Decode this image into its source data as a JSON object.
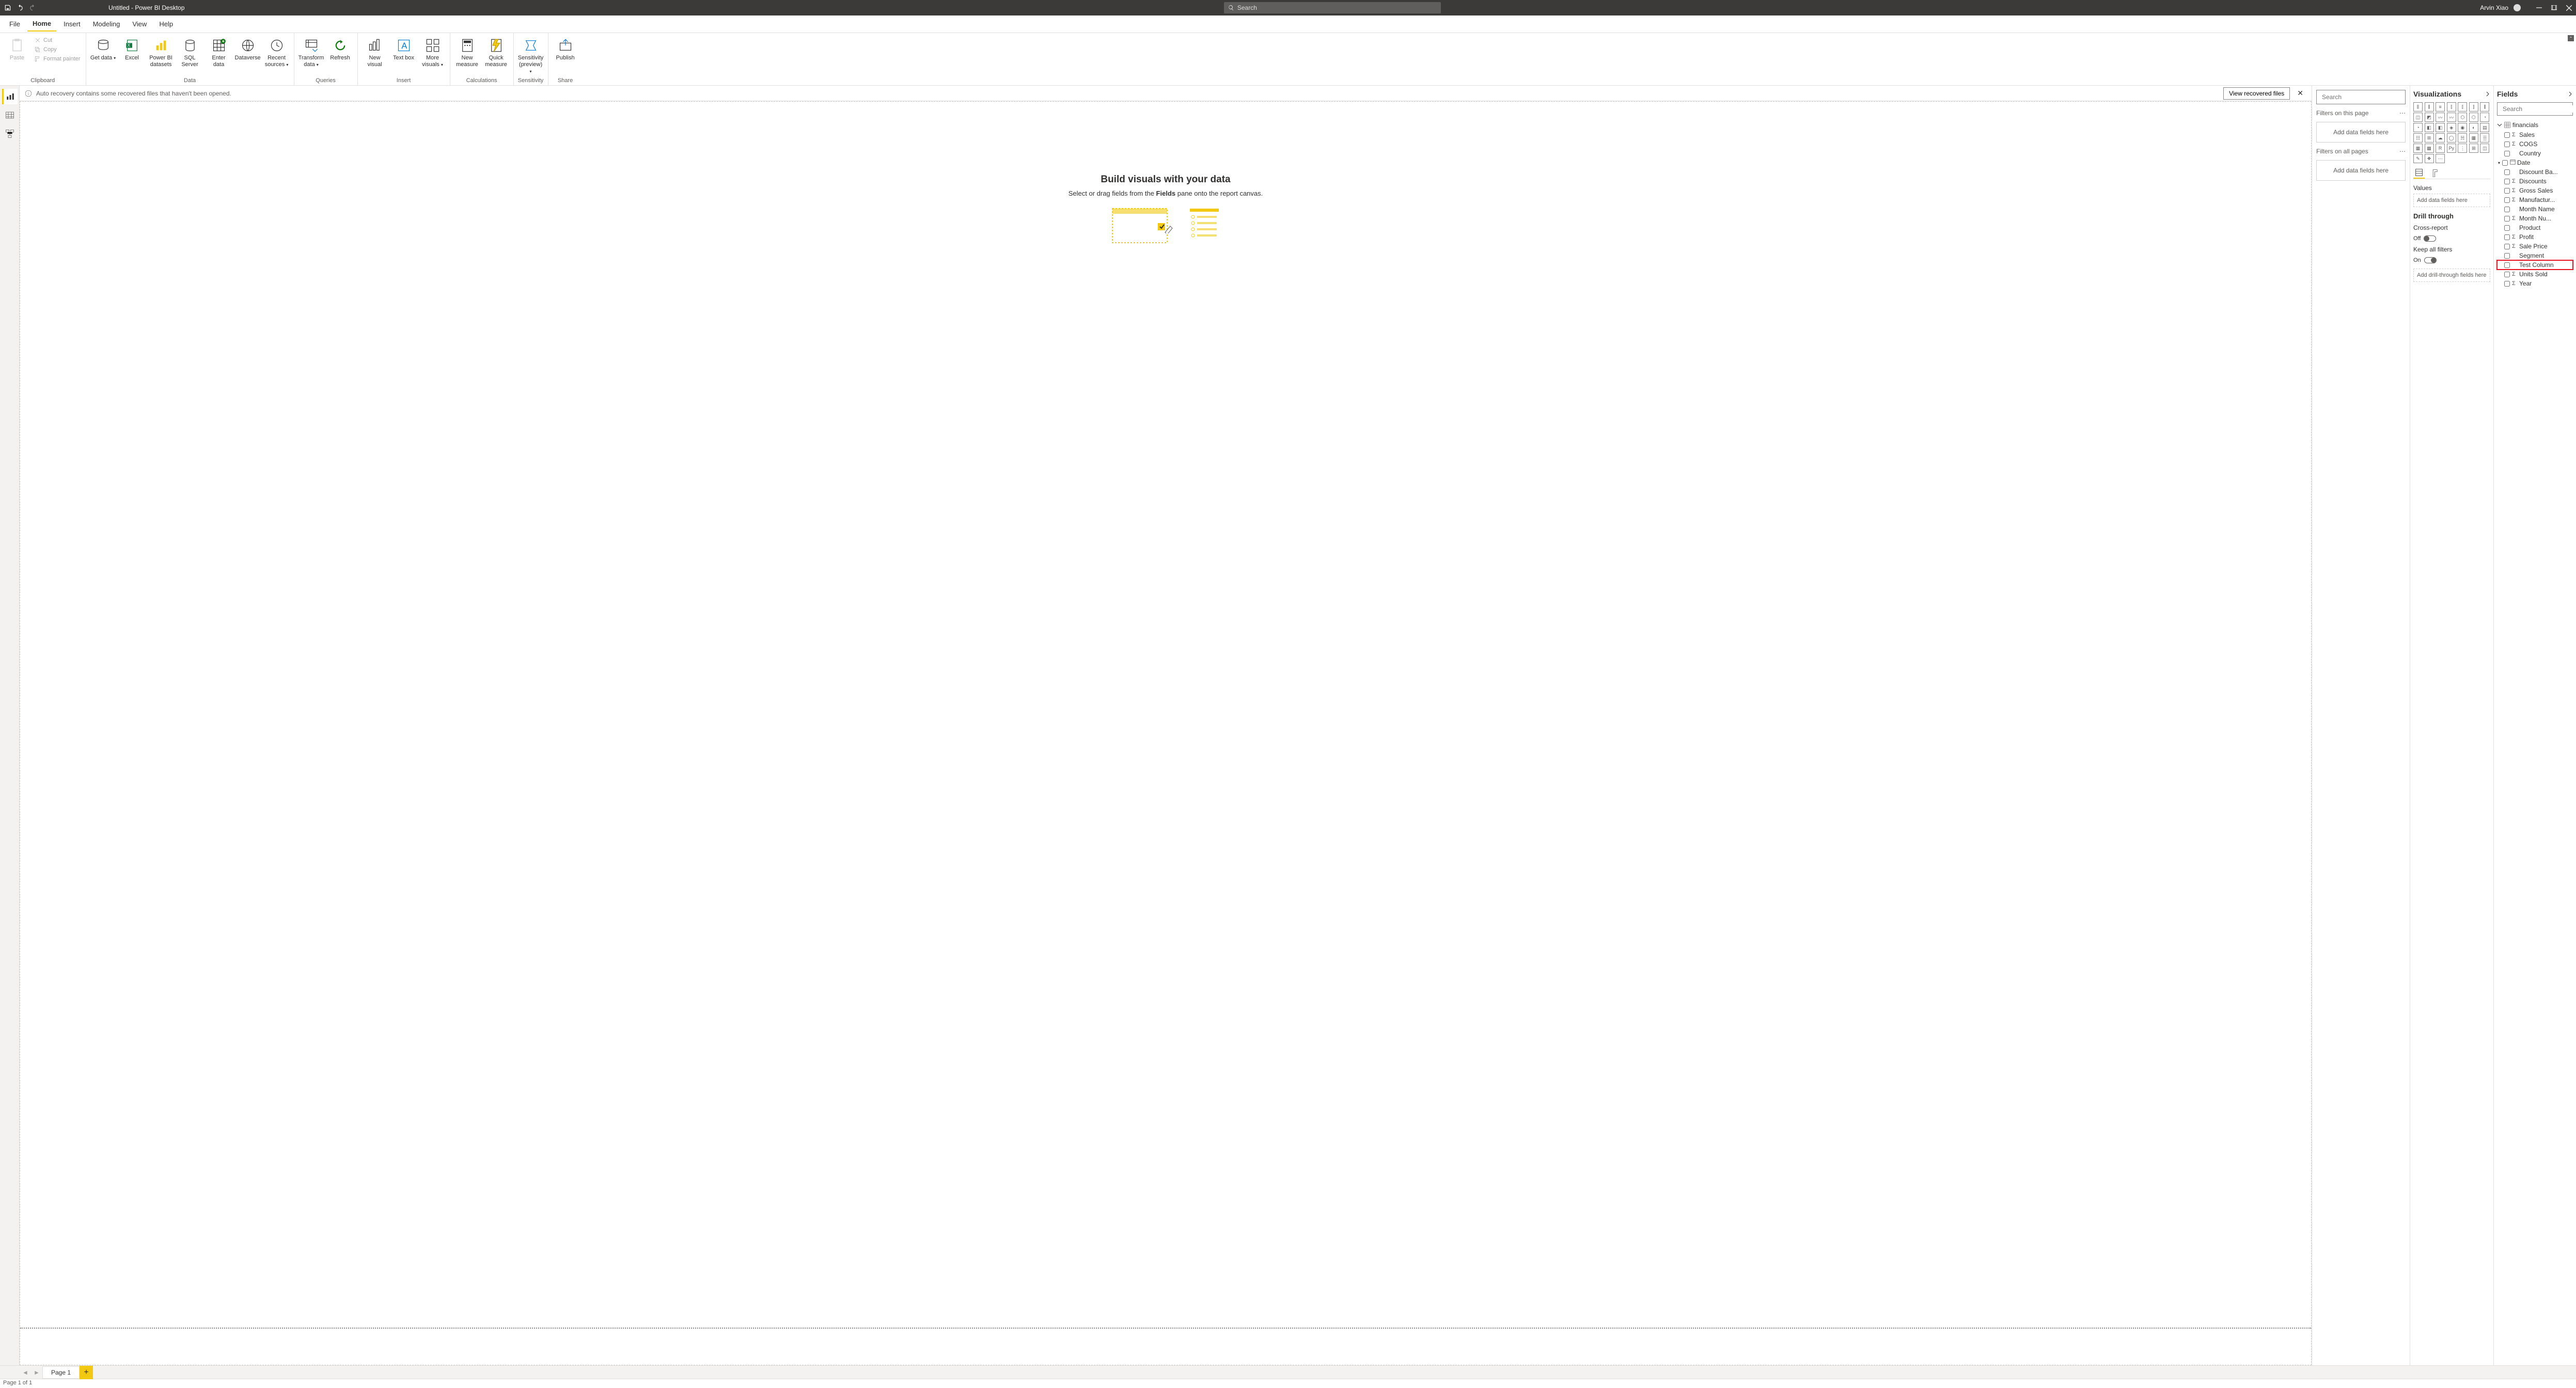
{
  "titlebar": {
    "title": "Untitled - Power BI Desktop",
    "search_placeholder": "Search",
    "user": "Arvin Xiao"
  },
  "menubar": {
    "items": [
      "File",
      "Home",
      "Insert",
      "Modeling",
      "View",
      "Help"
    ],
    "active": "Home"
  },
  "ribbon": {
    "clipboard": {
      "label": "Clipboard",
      "paste": "Paste",
      "cut": "Cut",
      "copy": "Copy",
      "format_painter": "Format painter"
    },
    "data": {
      "label": "Data",
      "get_data": "Get data",
      "excel": "Excel",
      "powerbi": "Power BI datasets",
      "sql": "SQL Server",
      "enter": "Enter data",
      "dataverse": "Dataverse",
      "recent": "Recent sources"
    },
    "queries": {
      "label": "Queries",
      "transform": "Transform data",
      "refresh": "Refresh"
    },
    "insert": {
      "label": "Insert",
      "newvisual": "New visual",
      "textbox": "Text box",
      "more": "More visuals"
    },
    "calc": {
      "label": "Calculations",
      "newmeasure": "New measure",
      "quick": "Quick measure"
    },
    "sens": {
      "label": "Sensitivity",
      "sens": "Sensitivity (preview)"
    },
    "share": {
      "label": "Share",
      "publish": "Publish"
    }
  },
  "notification": {
    "text": "Auto recovery contains some recovered files that haven't been opened.",
    "button": "View recovered files"
  },
  "canvas": {
    "heading": "Build visuals with your data",
    "sub_pre": "Select or drag fields from the ",
    "sub_bold": "Fields",
    "sub_post": " pane onto the report canvas."
  },
  "filters": {
    "search": "Search",
    "page": "Filters on this page",
    "all": "Filters on all pages",
    "drop": "Add data fields here"
  },
  "viz": {
    "title": "Visualizations",
    "values": "Values",
    "values_drop": "Add data fields here",
    "drill": "Drill through",
    "cross": "Cross-report",
    "off": "Off",
    "keep": "Keep all filters",
    "on": "On",
    "drill_drop": "Add drill-through fields here"
  },
  "fields": {
    "title": "Fields",
    "search": "Search",
    "table": "financials",
    "cols": [
      {
        "name": "Sales",
        "sum": true
      },
      {
        "name": "COGS",
        "sum": true
      },
      {
        "name": "Country",
        "sum": false
      },
      {
        "name": "Date",
        "sum": false,
        "date": true
      },
      {
        "name": "Discount Ba...",
        "sum": false
      },
      {
        "name": "Discounts",
        "sum": true
      },
      {
        "name": "Gross Sales",
        "sum": true
      },
      {
        "name": "Manufactur...",
        "sum": true
      },
      {
        "name": "Month Name",
        "sum": false
      },
      {
        "name": "Month Nu...",
        "sum": true
      },
      {
        "name": "Product",
        "sum": false
      },
      {
        "name": "Profit",
        "sum": true
      },
      {
        "name": "Sale Price",
        "sum": true
      },
      {
        "name": "Segment",
        "sum": false
      },
      {
        "name": "Test Column",
        "sum": false,
        "hl": true
      },
      {
        "name": "Units Sold",
        "sum": true
      },
      {
        "name": "Year",
        "sum": true
      }
    ]
  },
  "tabs": {
    "page": "Page 1"
  },
  "status": "Page 1 of 1"
}
